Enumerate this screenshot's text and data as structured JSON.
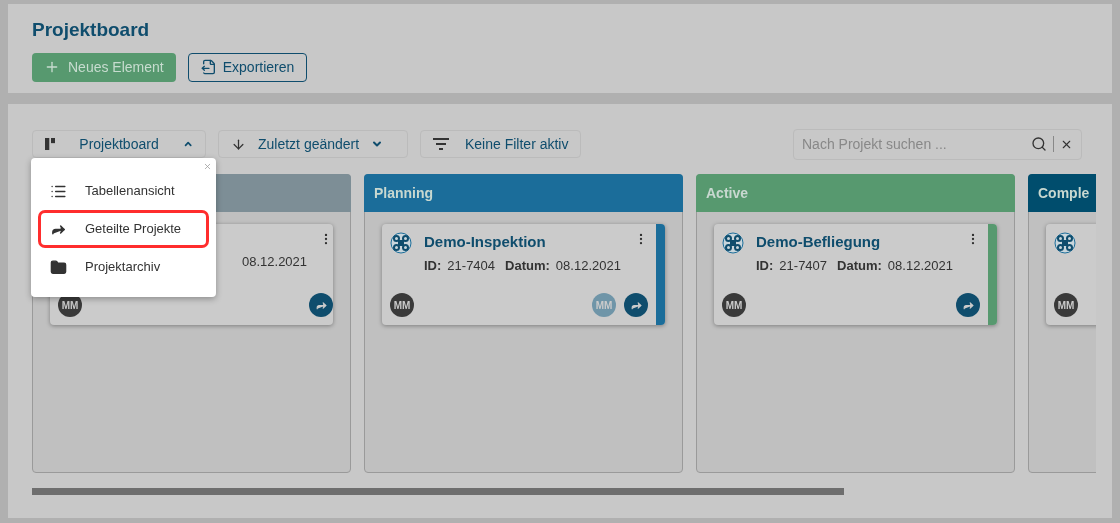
{
  "header": {
    "title": "Projektboard",
    "buttons": [
      {
        "kind": "primary",
        "label": "Neues Element"
      },
      {
        "kind": "outline",
        "label": "Exportieren"
      }
    ]
  },
  "toolbar": {
    "view": {
      "label": "Projektboard",
      "expanded": true
    },
    "sort": {
      "label": "Zuletzt geändert"
    },
    "filter": {
      "label": "Keine Filter aktiv"
    },
    "search": {
      "placeholder": "Nach Projekt suchen ..."
    }
  },
  "view_menu": {
    "items": [
      {
        "label": "Tabellenansicht",
        "highlighted": false
      },
      {
        "label": "Geteilte Projekte",
        "highlighted": true
      },
      {
        "label": "Projektarchiv",
        "highlighted": false
      }
    ]
  },
  "columns": [
    {
      "color": "#7d8e96",
      "cards": [
        {
          "date": "08.12.2021",
          "avatars": [
            {
              "initials": "MM",
              "color": "#3a3a3a"
            }
          ]
        }
      ]
    },
    {
      "title": "Planning",
      "color": "#1b6d9a",
      "cards": [
        {
          "title": "Demo-Inspektion",
          "id_label": "ID:",
          "id": "21-7404",
          "date_label": "Datum:",
          "date": "08.12.2021",
          "avatars": [
            {
              "initials": "MM",
              "color": "#3a3a3a"
            },
            {
              "initials": "MM",
              "color": "#6f95a8"
            }
          ]
        }
      ]
    },
    {
      "title": "Active",
      "color": "#57996f",
      "cards": [
        {
          "title": "Demo-Befliegung",
          "id_label": "ID:",
          "id": "21-7407",
          "date_label": "Datum:",
          "date": "08.12.2021",
          "avatars": [
            {
              "initials": "MM",
              "color": "#3a3a3a"
            }
          ]
        }
      ]
    },
    {
      "title": "Comple",
      "color": "#004d6d",
      "cards": [
        {
          "avatars": [
            {
              "initials": "MM",
              "color": "#3a3a3a"
            }
          ]
        }
      ]
    }
  ]
}
